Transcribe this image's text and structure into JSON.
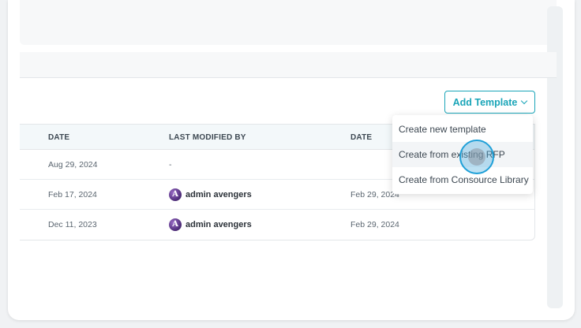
{
  "toolbar": {
    "add_template_label": "Add Template"
  },
  "table": {
    "headers": {
      "date": "DATE",
      "last_modified_by": "LAST MODIFIED BY",
      "date2": "DATE"
    },
    "rows": [
      {
        "date": "Aug 29, 2024",
        "modified_by": "-",
        "modified_date": ""
      },
      {
        "date": "Feb 17, 2024",
        "modified_by": "admin avengers",
        "modified_date": "Feb 29, 2024"
      },
      {
        "date": "Dec 11, 2023",
        "modified_by": "admin avengers",
        "modified_date": "Feb 29, 2024"
      }
    ]
  },
  "dropdown": {
    "items": [
      {
        "label": "Create new template"
      },
      {
        "label": "Create from existing RFP"
      },
      {
        "label": "Create from Consource Library"
      }
    ]
  },
  "colors": {
    "accent": "#1aa5b8",
    "cursor": "#1fa0d8"
  },
  "icons": {
    "avatar": "avengers-logo-avatar",
    "add_template_chevron": "chevron-down-icon"
  }
}
